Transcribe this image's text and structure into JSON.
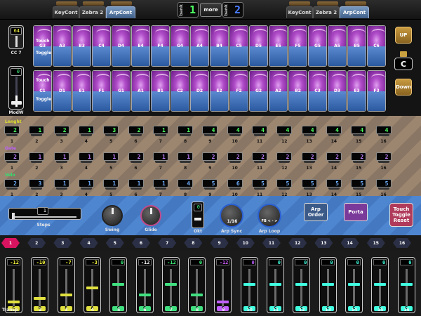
{
  "topbar": {
    "left_tabs": [
      "KeyCont",
      "Zebra 2",
      "ArpCont"
    ],
    "right_tabs": [
      "KeyCont",
      "Zebra 2",
      "ArpCont"
    ],
    "active_tab": "ArpCont",
    "bank_label": "bank",
    "bank_left_value": "1",
    "bank_right_value": "2",
    "more_label": "more",
    "bank_left_color": "#4cff60",
    "bank_right_color": "#4a7cff"
  },
  "keyboard": {
    "cc_value": "64",
    "cc_label": "CC 7",
    "modw_value": "0",
    "modw_label": "ModW",
    "touch_label": "Touch",
    "toggle_label": "Toggle",
    "upper_notes": [
      "G3",
      "A3",
      "B3",
      "C4",
      "D4",
      "E4",
      "F4",
      "G4",
      "A4",
      "B4",
      "C5",
      "D5",
      "E5",
      "F5",
      "G5",
      "A5",
      "B5",
      "C6"
    ],
    "lower_notes": [
      "C1",
      "D1",
      "E1",
      "F1",
      "G1",
      "A1",
      "B1",
      "C2",
      "D2",
      "E2",
      "F2",
      "G2",
      "A2",
      "B2",
      "C3",
      "D3",
      "E3",
      "F3"
    ],
    "up_label": "UP",
    "down_label": "Down",
    "key_value": "C"
  },
  "sequencer": {
    "rows": [
      {
        "title": "Lenght",
        "color": "#e0e030",
        "values": [
          "2",
          "1",
          "2",
          "1",
          "3",
          "2",
          "1",
          "1",
          "4",
          "4",
          "4",
          "4",
          "4",
          "4",
          "4",
          "4"
        ],
        "value_color": "#4cff60"
      },
      {
        "title": "Gate",
        "color": "#c060ff",
        "values": [
          "2",
          "1",
          "1",
          "1",
          "1",
          "2",
          "1",
          "1",
          "2",
          "2",
          "2",
          "2",
          "2",
          "2",
          "2",
          "2"
        ],
        "value_color": "#c080ff"
      },
      {
        "title": "Velo",
        "color": "#30e070",
        "values": [
          "2",
          "3",
          "1",
          "1",
          "1",
          "1",
          "1",
          "4",
          "5",
          "6",
          "5",
          "5",
          "5",
          "5",
          "5",
          "5"
        ],
        "value_color": "#70b0ff"
      }
    ],
    "step_numbers": [
      "1",
      "2",
      "3",
      "4",
      "5",
      "6",
      "7",
      "8",
      "9",
      "10",
      "11",
      "12",
      "13",
      "14",
      "15",
      "16"
    ]
  },
  "controls": {
    "steps_value": "1",
    "steps_label": "Steps",
    "swing_label": "Swing",
    "glide_label": "Glide",
    "okt_value": "0",
    "okt_label": "Okt",
    "arp_sync_value": "1/16",
    "arp_sync_label": "Arp Sync",
    "arp_loop_value": "FB < - >",
    "arp_loop_label": "Arp Loop",
    "arp_order_label": "Arp Order",
    "porta_label": "Porta",
    "touch_toggle_reset_label": "Touch Toggle Reset"
  },
  "step_selector": {
    "steps": [
      "1",
      "2",
      "3",
      "4",
      "5",
      "6",
      "7",
      "8",
      "9",
      "10",
      "11",
      "12",
      "13",
      "14",
      "15",
      "16"
    ],
    "active_step": 1
  },
  "transpose": {
    "label": "Transp",
    "values": [
      "-12",
      "-10",
      "-7",
      "-3",
      "0",
      "-12",
      "-12",
      "0",
      "-12",
      "0",
      "0",
      "0",
      "0",
      "0",
      "0",
      "0"
    ],
    "notes": [
      "C",
      "D",
      "F",
      "A",
      "C",
      "C",
      "C",
      "C",
      "C",
      "C",
      "C",
      "C",
      "C",
      "C",
      "C",
      "C"
    ],
    "value_colors": [
      "#ffff40",
      "#ffff40",
      "#ffff40",
      "#ffff40",
      "#40ff80",
      "#ffffff",
      "#40ff80",
      "#40ff80",
      "#d060ff",
      "#c060ff",
      "#40ffe0",
      "#40ffe0",
      "#40ffe0",
      "#40ffe0",
      "#40ffe0",
      "#40ffe0"
    ],
    "note_colors": [
      "#e0e040",
      "#e0e040",
      "#e0e040",
      "#e0e040",
      "#40e080",
      "#40e080",
      "#40e080",
      "#40e080",
      "#c060ff",
      "#40ffe0",
      "#40ffe0",
      "#40ffe0",
      "#40ffe0",
      "#40ffe0",
      "#40ffe0",
      "#40ffe0"
    ],
    "levels": [
      0.1,
      0.2,
      0.3,
      0.5,
      0.6,
      0.3,
      0.6,
      0.3,
      0.1,
      0.6,
      0.6,
      0.6,
      0.6,
      0.6,
      0.6,
      0.6
    ]
  }
}
